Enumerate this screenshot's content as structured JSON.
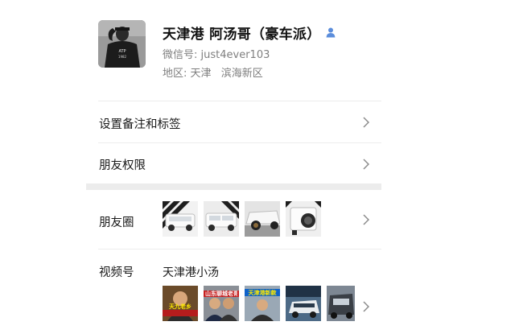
{
  "profile": {
    "name": "天津港 阿汤哥（豪车派）",
    "wechat_label": "微信号:",
    "wechat_id": "just4ever103",
    "region_label": "地区:",
    "region_city": "天津",
    "region_district": "滨海新区",
    "gender_icon": "person-icon",
    "gender_color": "#5b8ddb"
  },
  "menu": {
    "remark_label": "设置备注和标签",
    "permission_label": "朋友权限",
    "moments_label": "朋友圈",
    "channels_label": "视频号",
    "channels_name": "天津港小汤"
  },
  "video_captions": [
    "天九老乡",
    "山东聊城老哥",
    "天津港新款"
  ]
}
